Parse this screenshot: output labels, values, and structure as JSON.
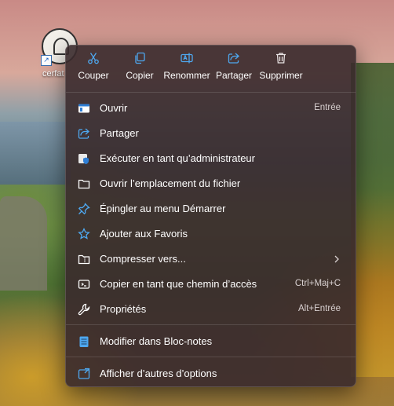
{
  "desktop": {
    "icon_label": "cerfat",
    "icon_name": "shortcut-document-icon"
  },
  "quick_actions": [
    {
      "label": "Couper",
      "icon": "cut-icon"
    },
    {
      "label": "Copier",
      "icon": "copy-icon"
    },
    {
      "label": "Renommer",
      "icon": "rename-icon"
    },
    {
      "label": "Partager",
      "icon": "share-icon"
    },
    {
      "label": "Supprimer",
      "icon": "delete-icon"
    }
  ],
  "menu_items": [
    {
      "label": "Ouvrir",
      "shortcut": "Entrée",
      "icon": "open-icon"
    },
    {
      "label": "Partager",
      "shortcut": "",
      "icon": "share-icon"
    },
    {
      "label": "Exécuter en tant qu’administrateur",
      "shortcut": "",
      "icon": "admin-shield-icon"
    },
    {
      "label": "Ouvrir l’emplacement du fichier",
      "shortcut": "",
      "icon": "folder-icon"
    },
    {
      "label": "Épingler au menu Démarrer",
      "shortcut": "",
      "icon": "pin-icon"
    },
    {
      "label": "Ajouter aux Favoris",
      "shortcut": "",
      "icon": "star-icon"
    },
    {
      "label": "Compresser vers...",
      "shortcut": "",
      "icon": "compress-folder-icon",
      "submenu": true
    },
    {
      "label": "Copier en tant que chemin d’accès",
      "shortcut": "Ctrl+Maj+C",
      "icon": "copy-path-icon"
    },
    {
      "label": "Propriétés",
      "shortcut": "Alt+Entrée",
      "icon": "wrench-icon"
    },
    {
      "label": "Modifier dans Bloc-notes",
      "shortcut": "",
      "icon": "notepad-icon"
    },
    {
      "label": "Afficher d’autres d’options",
      "shortcut": "",
      "icon": "more-options-icon"
    }
  ],
  "colors": {
    "menu_bg": "#3a2a2c",
    "accent": "#4ea8f0",
    "text": "#ffffff"
  }
}
